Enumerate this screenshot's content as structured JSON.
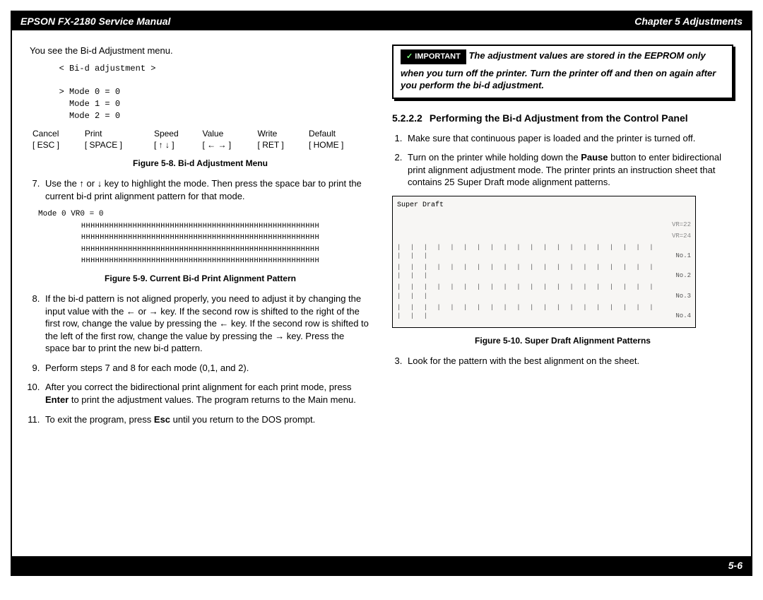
{
  "header": {
    "left": "EPSON FX-2180 Service Manual",
    "right": "Chapter 5  Adjustments"
  },
  "left": {
    "intro": "You see the Bi-d Adjustment menu.",
    "menu": "   < Bi-d adjustment >\n\n   > Mode 0 = 0\n     Mode 1 = 0\n     Mode 2 = 0",
    "menubar": {
      "r1": [
        "Cancel",
        "Print",
        "Speed",
        "Value",
        "Write",
        "Default"
      ],
      "r2": [
        "[ ESC ]",
        "[ SPACE ]",
        "[  ↑   ↓  ]",
        "[ ←     → ]",
        "[ RET ]",
        "[ HOME ]"
      ]
    },
    "fig8": "Figure 5-8. Bi-d Adjustment Menu",
    "step7": "Use the ↑ or ↓ key to highlight the mode. Then press the space bar to print the current bi-d print alignment pattern for that mode.",
    "mode0": "Mode 0   VR0 = 0",
    "hrow": "HHHHHHHHHHHHHHHHHHHHHHHHHHHHHHHHHHHHHHHHHHHHHHHHHHH",
    "fig9": "Figure 5-9. Current Bi-d Print Alignment Pattern",
    "step8_a": "If the bi-d pattern is not aligned properly, you need to adjust it by changing the input value with the ← or → key. If the second row is shifted to the right of the first row, change the value by pressing the ← key. If the second row is shifted to the left of the first row, change the value by pressing the → key. Press the space bar to print the new bi-d pattern.",
    "step9": "Perform steps 7 and 8 for each mode (0,1, and 2).",
    "step10_a": "After you correct the bidirectional print alignment for each print mode, press ",
    "step10_b": "Enter",
    "step10_c": " to print the adjustment values. The program returns to the Main menu.",
    "step11_a": "To exit the program, press ",
    "step11_b": "Esc",
    "step11_c": " until you return to the DOS prompt."
  },
  "right": {
    "important_label": "IMPORTANT",
    "important_text": "The adjustment values are stored in the EEPROM only when you turn off the printer. Turn the printer off and then on again after you perform the bi-d adjustment.",
    "section_num": "5.2.2.2",
    "section_title": "Performing the Bi-d Adjustment from the Control Panel",
    "step1": "Make sure that continuous paper is loaded and the printer is turned off.",
    "step2_a": "Turn on the printer while holding down the ",
    "step2_b": "Pause",
    "step2_c": " button to enter bidirectional print alignment adjustment mode. The printer prints an instruction sheet that contains 25 Super Draft mode alignment patterns.",
    "fig_title": "Super Draft",
    "offlabels": {
      "a": "VR=22",
      "b": "VR=24"
    },
    "rows": [
      "No.1",
      "No.2",
      "No.3",
      "No.4"
    ],
    "ticks": "| | | | | | | | | | | | | | | | | | | | | | |",
    "fig10": "Figure 5-10. Super Draft Alignment Patterns",
    "step3": "Look for the pattern with the best alignment on the sheet."
  },
  "footer": "5-6"
}
